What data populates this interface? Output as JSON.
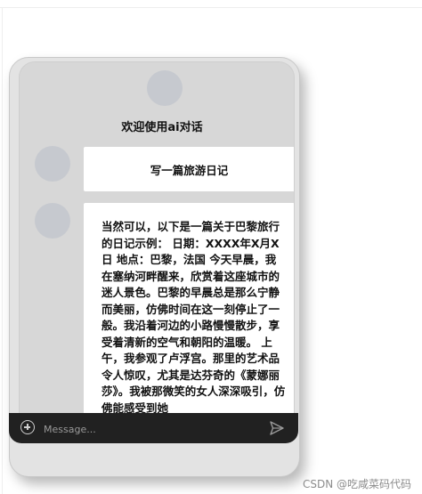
{
  "chat": {
    "title": "欢迎使用ai对话",
    "user_message": "写一篇旅游日记",
    "ai_message": "当然可以，以下是一篇关于巴黎旅行的日记示例：  日期：XXXX年X月X日 地点：巴黎，法国 今天早晨，我在塞纳河畔醒来，欣赏着这座城市的迷人景色。巴黎的早晨总是那么宁静而美丽，仿佛时间在这一刻停止了一般。我沿着河边的小路慢慢散步，享受着清新的空气和朝阳的温暖。 上午，我参观了卢浮宫。那里的艺术品令人惊叹，尤其是达芬奇的《蒙娜丽莎》。我被那微笑的女人深深吸引，仿佛能感受到她"
  },
  "input": {
    "placeholder": "Message..."
  },
  "icons": {
    "left": "plus-circle-icon",
    "right": "send-icon"
  },
  "footer": {
    "watermark": "CSDN @吃咸菜码代码"
  },
  "colors": {
    "input_bar": "#212121",
    "card_bg": "#e3e3e3",
    "avatar": "#c6c9cf"
  }
}
